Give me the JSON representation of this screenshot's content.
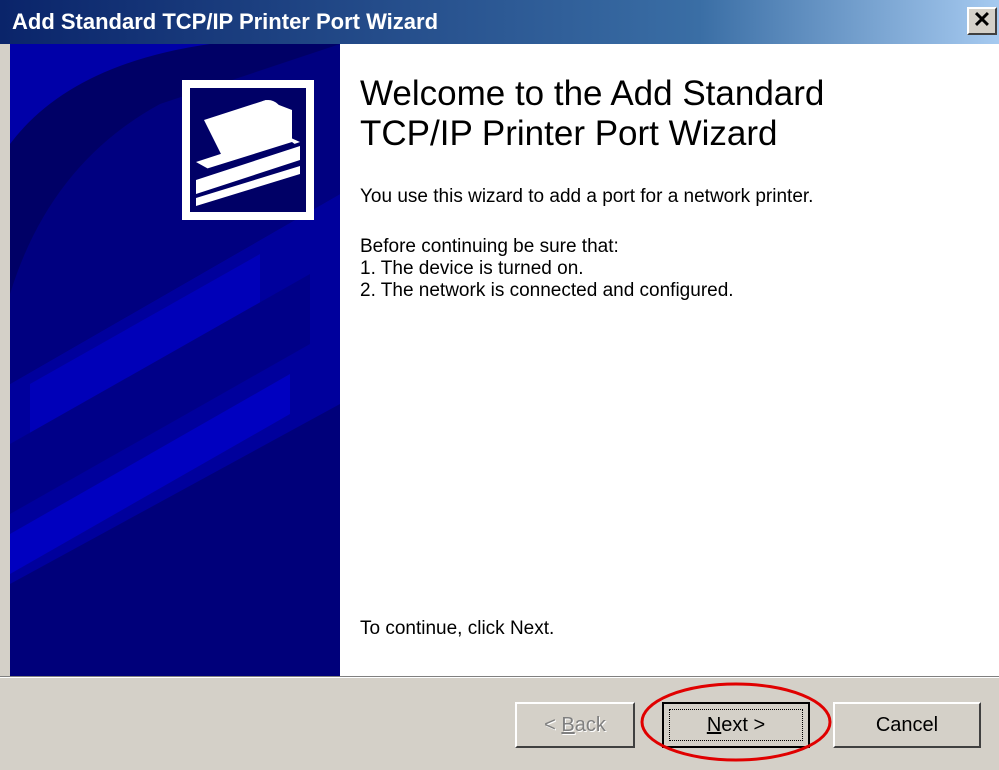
{
  "window": {
    "title": "Add Standard TCP/IP Printer Port Wizard",
    "close_glyph": "✕"
  },
  "content": {
    "title_line1": "Welcome to the Add Standard",
    "title_line2": "TCP/IP Printer Port Wizard",
    "intro": "You use this wizard to add a port for a network printer.",
    "requirements_header": "Before continuing be sure that:",
    "requirement_1": "1.  The device is turned on.",
    "requirement_2": "2.  The network is connected and configured.",
    "continue_text": "To continue, click Next."
  },
  "buttons": {
    "back_prefix": "< ",
    "back_mnemonic": "B",
    "back_rest": "ack",
    "next_mnemonic": "N",
    "next_rest": "ext >",
    "cancel": "Cancel"
  },
  "icons": {
    "wizard": "printer-wizard-icon",
    "close": "close-icon"
  },
  "colors": {
    "title_gradient_start": "#0a246a",
    "side_panel": "#000066",
    "annotation_ellipse": "#e00000"
  }
}
